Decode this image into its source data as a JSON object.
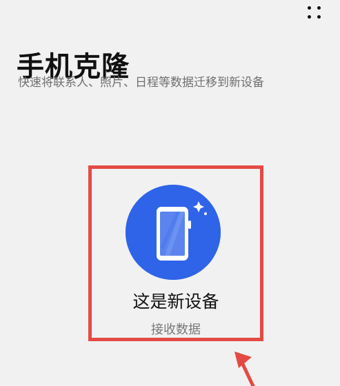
{
  "header": {
    "title": "手机克隆",
    "subtitle": "快速将联系人、照片、日程等数据迁移到新设备"
  },
  "toolbar": {
    "more_icon": "more-options-icon"
  },
  "new_device_option": {
    "title": "这是新设备",
    "subtitle": "接收数据",
    "icon": "phone-sparkle-icon"
  },
  "colors": {
    "background": "#f1f1f1",
    "accent_blue": "#2f64e8",
    "highlight_red": "#e44a43"
  }
}
